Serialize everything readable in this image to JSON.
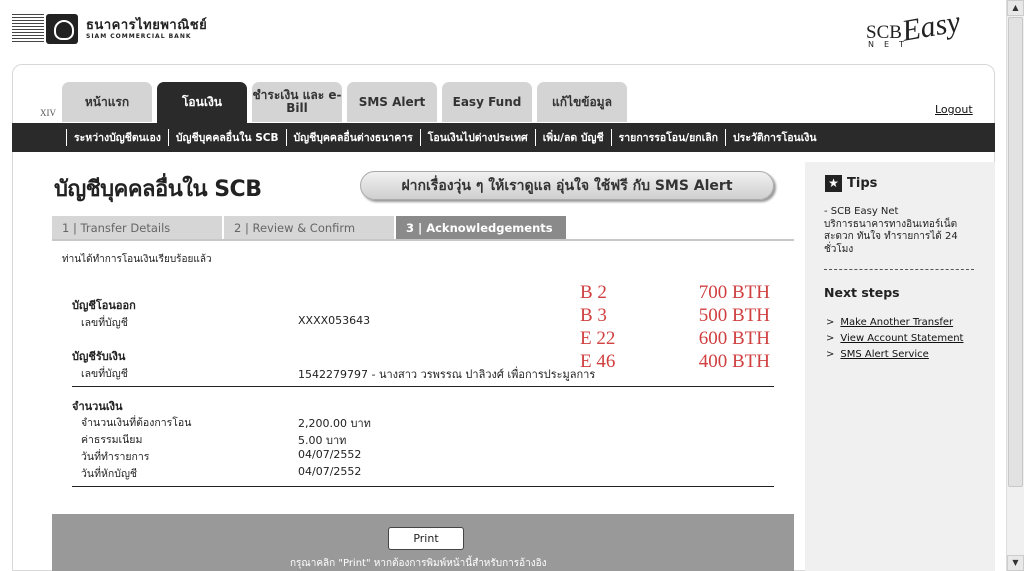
{
  "header": {
    "bank_name_th": "ธนาคารไทยพาณิชย์",
    "bank_name_en": "SIAM COMMERCIAL BANK",
    "brand_scb": "SCB",
    "brand_easy": "Easy",
    "brand_net": "NET"
  },
  "version": "XIV",
  "tabs": [
    {
      "label": "หน้าแรก",
      "active": false
    },
    {
      "label": "โอนเงิน",
      "active": true
    },
    {
      "label": "ชำระเงิน และ e-Bill",
      "active": false
    },
    {
      "label": "SMS Alert",
      "active": false
    },
    {
      "label": "Easy Fund",
      "active": false
    },
    {
      "label": "แก้ไขข้อมูล",
      "active": false
    }
  ],
  "logout": "Logout",
  "subnav": [
    "ระหว่างบัญชีตนเอง",
    "บัญชีบุคคลอื่นใน SCB",
    "บัญชีบุคคลอื่นต่างธนาคาร",
    "โอนเงินไปต่างประเทศ",
    "เพิ่ม/ลด บัญชี",
    "รายการรอโอน/ยกเลิก",
    "ประวัติการโอนเงิน"
  ],
  "page_title": "บัญชีบุคคลอื่นใน SCB",
  "promo": "ฝากเรื่องวุ่น ๆ ให้เราดูแล อุ่นใจ ใช้ฟรี กับ SMS Alert",
  "steps": [
    {
      "label": "1 | Transfer Details",
      "active": false
    },
    {
      "label": "2 | Review & Confirm",
      "active": false
    },
    {
      "label": "3 | Acknowledgements",
      "active": true
    }
  ],
  "done_message": "ท่านได้ทำการโอนเงินเรียบร้อยแล้ว",
  "from_account": {
    "section": "บัญชีโอนออก",
    "label": "เลขที่บัญชี",
    "value": "XXXX053643"
  },
  "to_account": {
    "section": "บัญชีรับเงิน",
    "label": "เลขที่บัญชี",
    "value": "1542279797 - นางสาว วรพรรณ ปาลิวงศ์ เพื่อการประมูลการ"
  },
  "amount": {
    "section": "จำนวนเงิน",
    "rows": [
      {
        "label": "จำนวนเงินที่ต้องการโอน",
        "value": "2,200.00 บาท"
      },
      {
        "label": "ค่าธรรมเนียม",
        "value": "5.00 บาท"
      },
      {
        "label": "วันที่ทำรายการ",
        "value": "04/07/2552"
      },
      {
        "label": "วันที่หักบัญชี",
        "value": "04/07/2552"
      }
    ]
  },
  "handwritten_notes": [
    {
      "code": "B 2",
      "amount": "700 BTH"
    },
    {
      "code": "B 3",
      "amount": "500 BTH"
    },
    {
      "code": "E 22",
      "amount": "600 BTH"
    },
    {
      "code": "E 46",
      "amount": "400 BTH"
    }
  ],
  "print": {
    "button": "Print",
    "hint": "กรุณาคลิก \"Print\" หากต้องการพิมพ์หน้านี้สำหรับการอ้างอิง"
  },
  "tips": {
    "title": "Tips",
    "body_line1": "- SCB Easy Net",
    "body_line2": "บริการธนาคารทางอินเทอร์เน็ต สะดวก ทันใจ ทำรายการได้ 24 ชั่วโมง",
    "next_steps_title": "Next steps",
    "links": [
      "Make Another Transfer",
      "View Account Statement",
      "SMS Alert Service"
    ]
  }
}
